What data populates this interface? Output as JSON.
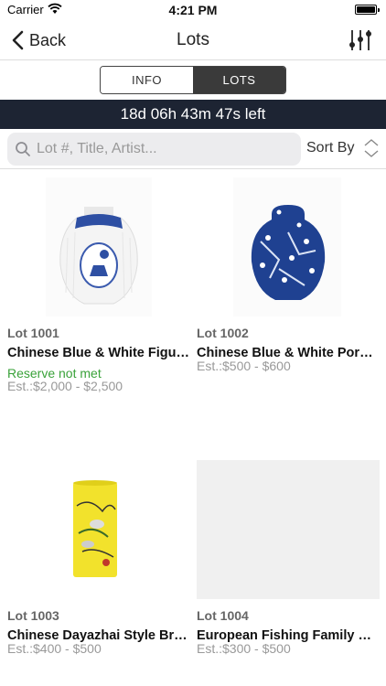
{
  "status_bar": {
    "carrier": "Carrier",
    "time": "4:21 PM"
  },
  "nav": {
    "back_label": "Back",
    "title": "Lots"
  },
  "segment": {
    "info": "INFO",
    "lots": "LOTS",
    "selected": "LOTS"
  },
  "countdown": "18d 06h 43m 47s left",
  "search": {
    "placeholder": "Lot #, Title, Artist...",
    "sort_label": "Sort By"
  },
  "lots": [
    {
      "lot": "Lot 1001",
      "title": "Chinese Blue & White Figural Jar",
      "reserve": "Reserve not met",
      "estimate": "Est.:$2,000 - $2,500"
    },
    {
      "lot": "Lot 1002",
      "title": "Chinese Blue & White Porcelain Jar",
      "reserve": "",
      "estimate": "Est.:$500 - $600"
    },
    {
      "lot": "Lot 1003",
      "title": "Chinese Dayazhai Style Brush Pot",
      "reserve": "",
      "estimate": "Est.:$400 - $500"
    },
    {
      "lot": "Lot 1004",
      "title": "European Fishing Family Model",
      "reserve": "",
      "estimate": "Est.:$300 - $500"
    }
  ],
  "colors": {
    "countdown_bg": "#1d2433",
    "reserve": "#3aa23a",
    "segment_active": "#3a3a3a"
  },
  "icons": [
    "wifi-icon",
    "battery-icon",
    "chevron-left-icon",
    "filter-sliders-icon",
    "search-icon",
    "sort-icon"
  ]
}
